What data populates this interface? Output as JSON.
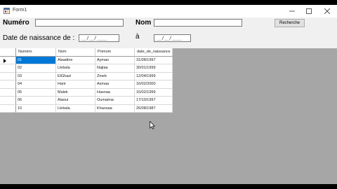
{
  "window": {
    "title": "Form1"
  },
  "form": {
    "numero_label": "Numéro",
    "nom_label": "Nom",
    "date_label": "Date de naissance de :",
    "a_label": "à",
    "date_from_value": "__/__/____",
    "date_to_value": "__/__/____",
    "search_button": "Recherche"
  },
  "grid": {
    "columns": [
      "Numéro",
      "Nom",
      "Prénom",
      "date_de_naissance"
    ],
    "rows": [
      [
        "01",
        "Alaadine",
        "Ayman",
        "31/08/1997"
      ],
      [
        "02",
        "Llebala",
        "Najlaa",
        "30/01/1999"
      ],
      [
        "03",
        "ElGhazi",
        "Zineb",
        "12/04/1999"
      ],
      [
        "04",
        "Harir",
        "Asmaa",
        "16/02/2000"
      ],
      [
        "05",
        "Malek",
        "Hasnaa",
        "15/02/1999"
      ],
      [
        "06",
        "Alaoui",
        "Oumaima",
        "17/10/1997"
      ],
      [
        "10",
        "Llebala",
        "Khansaa",
        "26/08/1987"
      ]
    ]
  },
  "colors": {
    "selection": "#0078d7",
    "background_area": "#a6a6a6",
    "window": "#f0f0f0"
  }
}
